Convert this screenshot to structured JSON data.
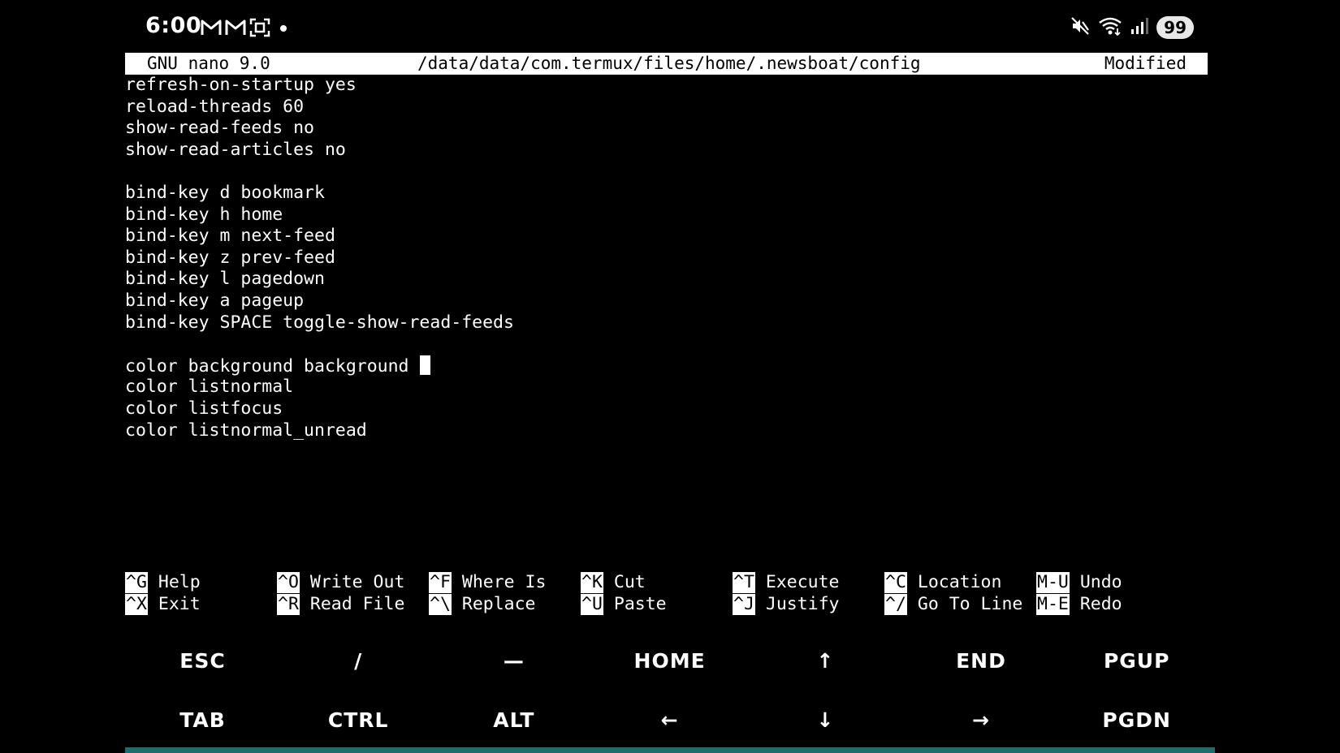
{
  "status_bar": {
    "time": "6:00",
    "left_icons": [
      "gmail-icon",
      "gmail-icon",
      "screenshot-icon",
      "dot-icon"
    ],
    "right_icons": [
      "mute-icon",
      "wifi-icon",
      "signal-icon"
    ],
    "battery": "99"
  },
  "title_bar": {
    "app": "GNU nano 9.0",
    "file_path": "/data/data/com.termux/files/home/.newsboat/config",
    "state": "Modified"
  },
  "editor": {
    "lines": [
      "refresh-on-startup yes",
      "reload-threads 60",
      "show-read-feeds no",
      "show-read-articles no",
      "",
      "bind-key d bookmark",
      "bind-key h home",
      "bind-key m next-feed",
      "bind-key z prev-feed",
      "bind-key l pagedown",
      "bind-key a pageup",
      "bind-key SPACE toggle-show-read-feeds",
      "",
      "color background background",
      "color listnormal",
      "color listfocus",
      "color listnormal_unread"
    ],
    "cursor_line": 14
  },
  "shortcuts": {
    "row1": [
      {
        "key": "^G",
        "label": "Help"
      },
      {
        "key": "^O",
        "label": "Write Out"
      },
      {
        "key": "^F",
        "label": "Where Is"
      },
      {
        "key": "^K",
        "label": "Cut"
      },
      {
        "key": "^T",
        "label": "Execute"
      },
      {
        "key": "^C",
        "label": "Location"
      },
      {
        "key": "M-U",
        "label": "Undo"
      }
    ],
    "row2": [
      {
        "key": "^X",
        "label": "Exit"
      },
      {
        "key": "^R",
        "label": "Read File"
      },
      {
        "key": "^\\",
        "label": "Replace"
      },
      {
        "key": "^U",
        "label": "Paste"
      },
      {
        "key": "^J",
        "label": "Justify"
      },
      {
        "key": "^/",
        "label": "Go To Line"
      },
      {
        "key": "M-E",
        "label": "Redo"
      }
    ]
  },
  "extra_keys": {
    "row1": [
      "ESC",
      "/",
      "—",
      "HOME",
      "↑",
      "END",
      "PGUP"
    ],
    "row2": [
      "TAB",
      "CTRL",
      "ALT",
      "←",
      "↓",
      "→",
      "PGDN"
    ]
  },
  "colors": {
    "background": "#000000",
    "foreground": "#ffffff",
    "accent": "#1e6e6e"
  }
}
